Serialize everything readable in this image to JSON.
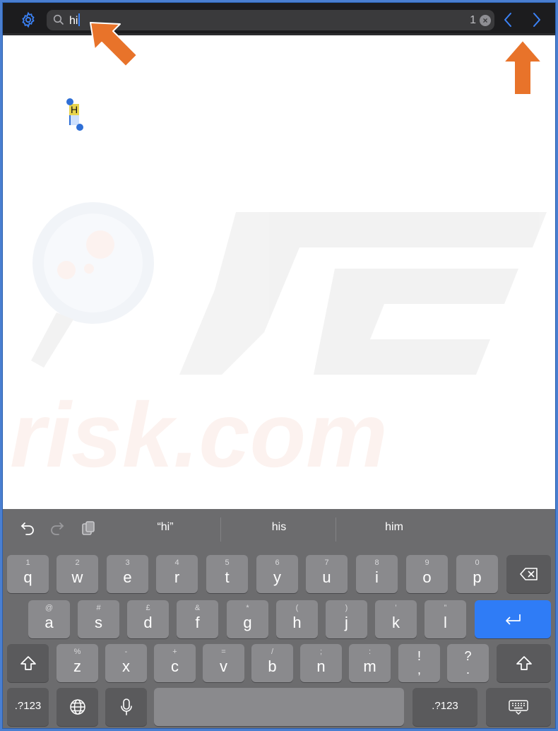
{
  "findbar": {
    "query": "hi",
    "match_count": "1",
    "clear_label": "×"
  },
  "document": {
    "match_text": "H",
    "watermark_text": "risk.com"
  },
  "keyboard": {
    "suggestions": [
      "“hi”",
      "his",
      "him"
    ],
    "row1": [
      {
        "sub": "1",
        "main": "q"
      },
      {
        "sub": "2",
        "main": "w"
      },
      {
        "sub": "3",
        "main": "e"
      },
      {
        "sub": "4",
        "main": "r"
      },
      {
        "sub": "5",
        "main": "t"
      },
      {
        "sub": "6",
        "main": "y"
      },
      {
        "sub": "7",
        "main": "u"
      },
      {
        "sub": "8",
        "main": "i"
      },
      {
        "sub": "9",
        "main": "o"
      },
      {
        "sub": "0",
        "main": "p"
      }
    ],
    "row2": [
      {
        "sub": "@",
        "main": "a"
      },
      {
        "sub": "#",
        "main": "s"
      },
      {
        "sub": "£",
        "main": "d"
      },
      {
        "sub": "&",
        "main": "f"
      },
      {
        "sub": "*",
        "main": "g"
      },
      {
        "sub": "(",
        "main": "h"
      },
      {
        "sub": ")",
        "main": "j"
      },
      {
        "sub": "’",
        "main": "k"
      },
      {
        "sub": "”",
        "main": "l"
      }
    ],
    "row3": [
      {
        "sub": "%",
        "main": "z"
      },
      {
        "sub": "-",
        "main": "x"
      },
      {
        "sub": "+",
        "main": "c"
      },
      {
        "sub": "=",
        "main": "v"
      },
      {
        "sub": "/",
        "main": "b"
      },
      {
        "sub": ";",
        "main": "n"
      },
      {
        "sub": ":",
        "main": "m"
      },
      {
        "sub": "!",
        "main": ","
      },
      {
        "sub": "?",
        "main": "."
      }
    ],
    "numbers_label": ".?123",
    "numbers_label_right": ".?123"
  },
  "colors": {
    "accent": "#2f7cf6",
    "annotation_arrow": "#e8732a",
    "highlight": "#e8d44d"
  },
  "icons": {
    "settings": "gear-icon",
    "search": "search-icon",
    "previous": "chevron-left-icon",
    "next": "chevron-right-icon",
    "undo": "undo-icon",
    "redo": "redo-icon",
    "paste": "clipboard-icon",
    "delete": "backspace-icon",
    "return": "return-icon",
    "shift": "shift-icon",
    "globe": "globe-icon",
    "mic": "microphone-icon",
    "dismiss": "keyboard-dismiss-icon"
  }
}
